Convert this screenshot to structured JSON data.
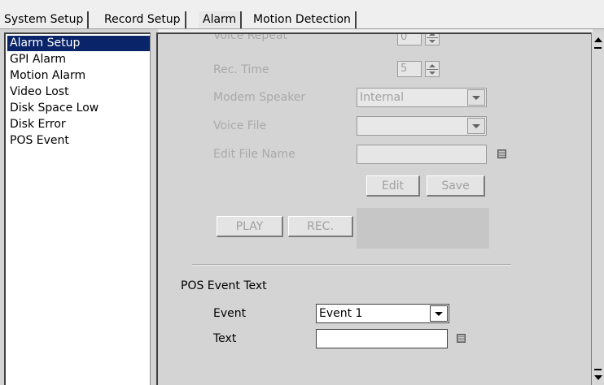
{
  "tabs": [
    {
      "label": "System Setup"
    },
    {
      "label": "Record Setup"
    },
    {
      "label": "Alarm"
    },
    {
      "label": "Motion Detection"
    }
  ],
  "sidebar": {
    "items": [
      {
        "label": "Alarm Setup",
        "selected": true
      },
      {
        "label": "GPI Alarm"
      },
      {
        "label": "Motion Alarm"
      },
      {
        "label": "Video Lost"
      },
      {
        "label": "Disk Space Low"
      },
      {
        "label": "Disk Error"
      },
      {
        "label": "POS Event"
      }
    ]
  },
  "form": {
    "voice_repeat": {
      "label": "Voice Repeat",
      "value": "0"
    },
    "rec_time": {
      "label": "Rec. Time",
      "value": "5"
    },
    "modem_speaker": {
      "label": "Modem Speaker",
      "value": "Internal"
    },
    "voice_file": {
      "label": "Voice File",
      "value": ""
    },
    "edit_file_name": {
      "label": "Edit File Name",
      "value": ""
    },
    "edit_button": "Edit",
    "save_button": "Save",
    "play_button": "PLAY",
    "rec_button": "REC."
  },
  "pos": {
    "section_title": "POS Event Text",
    "event_label": "Event",
    "event_value": "Event 1",
    "text_label": "Text",
    "text_value": ""
  },
  "icons": {
    "spin_up": "arrow-up-icon",
    "spin_down": "arrow-down-icon",
    "dropdown": "chevron-down-icon",
    "keyboard": "keyboard-icon",
    "scroll_up": "scroll-up-icon",
    "scroll_down": "scroll-down-icon"
  },
  "colors": {
    "selection": "#0a246a",
    "panel_bg": "#d4d4d4",
    "disabled_text": "#a9a9a9"
  }
}
